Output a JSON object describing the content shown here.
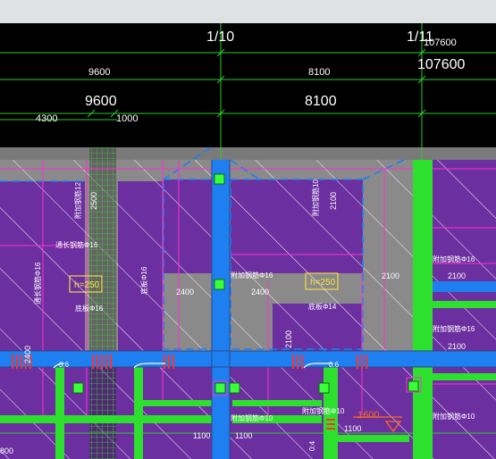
{
  "window": {
    "title_bar_color": "#dfe1e5"
  },
  "canvas": {
    "background": "#000000"
  },
  "header": {
    "axis_1": "1/10",
    "axis_2": "1/11",
    "axis_2_sub": "107600",
    "dim_small_1": "9600",
    "dim_small_2": "8100",
    "total": "107600",
    "dim_large_1": "9600",
    "dim_large_2": "8100",
    "dim_sub_1": "4300",
    "dim_sub_2": "1000"
  },
  "plan": {
    "colors": {
      "slab": "#6b2fa0",
      "floor": "#8a8a8a",
      "beam_blue": "#1e7ff0",
      "beam_green": "#2ee02e",
      "column": "#3cff3c",
      "magenta": "#ff2fd0",
      "dimension": "#2ecc2e",
      "label_yellow": "#ffe23c",
      "orange": "#ff6a1a",
      "red": "#ff3030"
    },
    "slab_labels": {
      "h_left": "h=250",
      "h_mid": "h=250",
      "slab_14": "底板Φ14",
      "slab_16": "底板Φ16",
      "cap_a": "附加钢筋Φ16",
      "cap_b": "附加钢筋Φ16",
      "cap_c": "附加钢筋Φ16",
      "cap_d": "附加钢筋Φ10",
      "cap_e": "附加钢筋Φ10",
      "top_a": "附加钢筋12",
      "top_b": "附加钢筋10",
      "left_a": "通长钢筋Φ16",
      "left_b": "通长钢筋Φ16"
    },
    "dims": {
      "d2400_a": "2400",
      "d2400_b": "2400",
      "d2400_c": "2400",
      "d2100_a": "2100",
      "d2100_b": "2100",
      "d2100_c": "2100",
      "d2100_d": "2100",
      "d2100_e": "2100",
      "d1100_a": "1100",
      "d1100_b": "1100",
      "d1100_c": "1100",
      "d1600": "1600",
      "d800": "800",
      "d2500": "2500",
      "s06_a": "0:6",
      "s06_b": "0:6",
      "s04": "0:4"
    }
  }
}
